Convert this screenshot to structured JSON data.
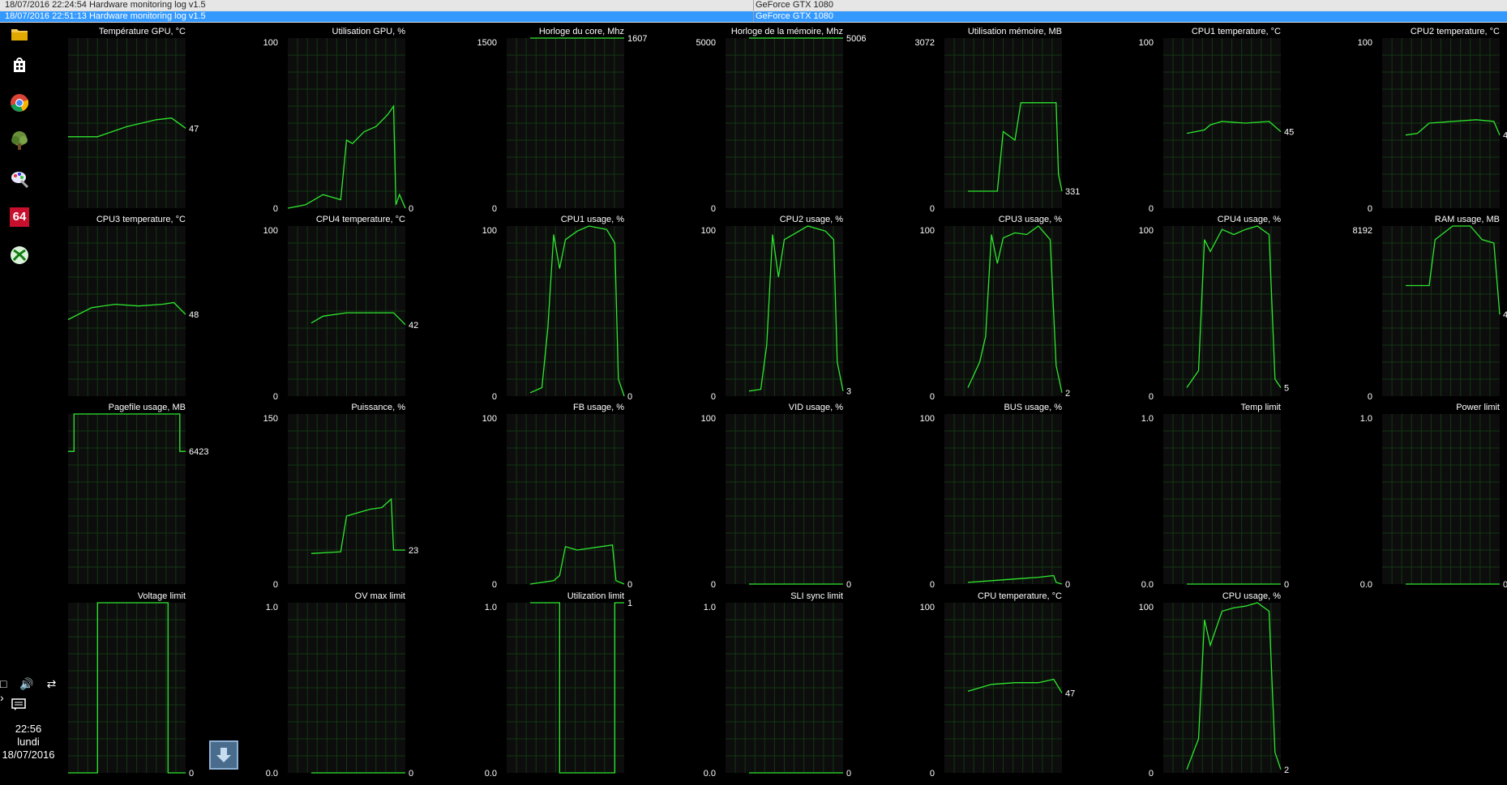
{
  "window": {
    "rows": [
      {
        "col1": "18/07/2016 22:24:54 Hardware monitoring log v1.5",
        "col2": "GeForce GTX 1080"
      },
      {
        "col1": "18/07/2016 22:51:13 Hardware monitoring log v1.5",
        "col2": "GeForce GTX 1080"
      }
    ]
  },
  "taskbar": {
    "icons": [
      "folder-icon",
      "store-icon",
      "chrome-icon",
      "tree-app-icon",
      "paint-icon",
      "aida64-icon",
      "xbox-icon"
    ],
    "aida_label": "64",
    "tray_icons": "□ 🔊 ⇄ ›",
    "time": "22:56",
    "day": "lundi",
    "date": "18/07/2016"
  },
  "colors": {
    "line": "#2ee82e",
    "grid": "#123812",
    "frame": "#0d0d0d"
  },
  "graphs": [
    {
      "title": "Température GPU, °C",
      "ymin": "",
      "ymax": "",
      "current": "47",
      "trace": [
        [
          0,
          42
        ],
        [
          0.25,
          42
        ],
        [
          0.5,
          48
        ],
        [
          0.75,
          52
        ],
        [
          0.88,
          53
        ],
        [
          1,
          47
        ]
      ]
    },
    {
      "title": "Utilisation GPU, %",
      "ymin": "0",
      "ymax": "100",
      "current": "0",
      "trace": [
        [
          0,
          0
        ],
        [
          0.15,
          2
        ],
        [
          0.3,
          8
        ],
        [
          0.45,
          5
        ],
        [
          0.5,
          40
        ],
        [
          0.55,
          38
        ],
        [
          0.65,
          45
        ],
        [
          0.75,
          48
        ],
        [
          0.85,
          55
        ],
        [
          0.9,
          60
        ],
        [
          0.92,
          2
        ],
        [
          0.95,
          8
        ],
        [
          1,
          0
        ]
      ]
    },
    {
      "title": "Horloge du core, Mhz",
      "ymin": "0",
      "ymax": "1500",
      "current": "1607",
      "trace": [
        [
          0.2,
          100
        ],
        [
          1,
          100
        ]
      ]
    },
    {
      "title": "Horloge de la mémoire, Mhz",
      "ymin": "0",
      "ymax": "5000",
      "current": "5006",
      "trace": [
        [
          0.2,
          100
        ],
        [
          1,
          100
        ]
      ]
    },
    {
      "title": "Utilisation mémoire, MB",
      "ymin": "0",
      "ymax": "3072",
      "current": "331",
      "trace": [
        [
          0.2,
          10
        ],
        [
          0.45,
          10
        ],
        [
          0.5,
          45
        ],
        [
          0.6,
          40
        ],
        [
          0.65,
          62
        ],
        [
          0.7,
          62
        ],
        [
          0.75,
          62
        ],
        [
          0.95,
          62
        ],
        [
          0.97,
          20
        ],
        [
          1,
          10
        ]
      ]
    },
    {
      "title": "CPU1 temperature, °C",
      "ymin": "0",
      "ymax": "100",
      "current": "45",
      "trace": [
        [
          0.2,
          44
        ],
        [
          0.35,
          46
        ],
        [
          0.4,
          49
        ],
        [
          0.5,
          51
        ],
        [
          0.7,
          50
        ],
        [
          0.9,
          51
        ],
        [
          1,
          45
        ]
      ]
    },
    {
      "title": "CPU2 temperature, °C",
      "ymin": "0",
      "ymax": "100",
      "current": "4",
      "trace": [
        [
          0.2,
          43
        ],
        [
          0.3,
          44
        ],
        [
          0.4,
          50
        ],
        [
          0.6,
          51
        ],
        [
          0.8,
          52
        ],
        [
          0.95,
          51
        ],
        [
          1,
          43
        ]
      ]
    },
    {
      "title": "CPU3 temperature, °C",
      "ymin": "",
      "ymax": "",
      "current": "48",
      "trace": [
        [
          0,
          45
        ],
        [
          0.2,
          52
        ],
        [
          0.4,
          54
        ],
        [
          0.6,
          53
        ],
        [
          0.8,
          54
        ],
        [
          0.9,
          55
        ],
        [
          1,
          48
        ]
      ]
    },
    {
      "title": "CPU4 temperature, °C",
      "ymin": "0",
      "ymax": "100",
      "current": "42",
      "trace": [
        [
          0.2,
          43
        ],
        [
          0.3,
          47
        ],
        [
          0.5,
          49
        ],
        [
          0.7,
          49
        ],
        [
          0.9,
          49
        ],
        [
          1,
          42
        ]
      ]
    },
    {
      "title": "CPU1 usage, %",
      "ymin": "0",
      "ymax": "100",
      "current": "0",
      "trace": [
        [
          0.2,
          2
        ],
        [
          0.3,
          5
        ],
        [
          0.35,
          40
        ],
        [
          0.4,
          95
        ],
        [
          0.45,
          75
        ],
        [
          0.5,
          92
        ],
        [
          0.6,
          97
        ],
        [
          0.7,
          100
        ],
        [
          0.85,
          98
        ],
        [
          0.92,
          90
        ],
        [
          0.95,
          10
        ],
        [
          1,
          0
        ]
      ]
    },
    {
      "title": "CPU2 usage, %",
      "ymin": "0",
      "ymax": "100",
      "current": "3",
      "trace": [
        [
          0.2,
          3
        ],
        [
          0.3,
          4
        ],
        [
          0.35,
          30
        ],
        [
          0.4,
          95
        ],
        [
          0.45,
          70
        ],
        [
          0.5,
          92
        ],
        [
          0.6,
          96
        ],
        [
          0.7,
          100
        ],
        [
          0.85,
          97
        ],
        [
          0.92,
          92
        ],
        [
          0.95,
          20
        ],
        [
          1,
          3
        ]
      ]
    },
    {
      "title": "CPU3 usage, %",
      "ymin": "0",
      "ymax": "100",
      "current": "2",
      "trace": [
        [
          0.2,
          5
        ],
        [
          0.3,
          20
        ],
        [
          0.35,
          35
        ],
        [
          0.4,
          95
        ],
        [
          0.45,
          78
        ],
        [
          0.5,
          93
        ],
        [
          0.6,
          96
        ],
        [
          0.7,
          95
        ],
        [
          0.8,
          100
        ],
        [
          0.9,
          92
        ],
        [
          0.95,
          18
        ],
        [
          1,
          2
        ]
      ]
    },
    {
      "title": "CPU4 usage, %",
      "ymin": "0",
      "ymax": "100",
      "current": "5",
      "trace": [
        [
          0.2,
          5
        ],
        [
          0.3,
          15
        ],
        [
          0.35,
          92
        ],
        [
          0.4,
          85
        ],
        [
          0.5,
          98
        ],
        [
          0.6,
          95
        ],
        [
          0.7,
          98
        ],
        [
          0.8,
          100
        ],
        [
          0.9,
          95
        ],
        [
          0.95,
          10
        ],
        [
          1,
          5
        ]
      ]
    },
    {
      "title": "RAM usage, MB",
      "ymin": "0",
      "ymax": "8192",
      "current": "4",
      "trace": [
        [
          0.2,
          65
        ],
        [
          0.4,
          65
        ],
        [
          0.45,
          92
        ],
        [
          0.6,
          100
        ],
        [
          0.75,
          100
        ],
        [
          0.85,
          92
        ],
        [
          0.95,
          90
        ],
        [
          1,
          48
        ]
      ]
    },
    {
      "title": "Pagefile usage, MB",
      "ymin": "",
      "ymax": "",
      "current": "6423",
      "trace": [
        [
          0,
          78
        ],
        [
          0.05,
          78
        ],
        [
          0.05,
          100
        ],
        [
          0.95,
          100
        ],
        [
          0.95,
          78
        ],
        [
          1,
          78
        ]
      ]
    },
    {
      "title": "Puissance, %",
      "ymin": "0",
      "ymax": "150",
      "current": "23",
      "trace": [
        [
          0.2,
          18
        ],
        [
          0.45,
          19
        ],
        [
          0.5,
          40
        ],
        [
          0.6,
          42
        ],
        [
          0.7,
          44
        ],
        [
          0.8,
          45
        ],
        [
          0.88,
          50
        ],
        [
          0.9,
          20
        ],
        [
          1,
          20
        ]
      ]
    },
    {
      "title": "FB usage, %",
      "ymin": "0",
      "ymax": "100",
      "current": "0",
      "trace": [
        [
          0.2,
          0
        ],
        [
          0.4,
          2
        ],
        [
          0.45,
          5
        ],
        [
          0.5,
          22
        ],
        [
          0.6,
          20
        ],
        [
          0.7,
          21
        ],
        [
          0.8,
          22
        ],
        [
          0.9,
          23
        ],
        [
          0.93,
          2
        ],
        [
          1,
          0
        ]
      ]
    },
    {
      "title": "VID usage, %",
      "ymin": "0",
      "ymax": "100",
      "current": "0",
      "trace": [
        [
          0.2,
          0
        ],
        [
          1,
          0
        ]
      ]
    },
    {
      "title": "BUS usage, %",
      "ymin": "0",
      "ymax": "100",
      "current": "0",
      "trace": [
        [
          0.2,
          1
        ],
        [
          0.4,
          2
        ],
        [
          0.6,
          3
        ],
        [
          0.8,
          4
        ],
        [
          0.93,
          5
        ],
        [
          0.95,
          1
        ],
        [
          1,
          0
        ]
      ]
    },
    {
      "title": "Temp limit",
      "ymin": "0.0",
      "ymax": "1.0",
      "current": "0",
      "trace": [
        [
          0.2,
          0
        ],
        [
          1,
          0
        ]
      ]
    },
    {
      "title": "Power limit",
      "ymin": "0.0",
      "ymax": "1.0",
      "current": "0",
      "trace": [
        [
          0.2,
          0
        ],
        [
          1,
          0
        ]
      ]
    },
    {
      "title": "Voltage limit",
      "ymin": "",
      "ymax": "",
      "current": "0",
      "trace": [
        [
          0,
          0
        ],
        [
          0.25,
          0
        ],
        [
          0.25,
          100
        ],
        [
          0.85,
          100
        ],
        [
          0.85,
          0
        ],
        [
          1,
          0
        ]
      ]
    },
    {
      "title": "OV max limit",
      "ymin": "0.0",
      "ymax": "1.0",
      "current": "0",
      "trace": [
        [
          0.2,
          0
        ],
        [
          1,
          0
        ]
      ]
    },
    {
      "title": "Utilization limit",
      "ymin": "0.0",
      "ymax": "1.0",
      "current": "1",
      "trace": [
        [
          0.2,
          100
        ],
        [
          0.45,
          100
        ],
        [
          0.45,
          0
        ],
        [
          0.92,
          0
        ],
        [
          0.92,
          100
        ],
        [
          1,
          100
        ]
      ]
    },
    {
      "title": "SLI sync limit",
      "ymin": "0.0",
      "ymax": "1.0",
      "current": "0",
      "trace": [
        [
          0.2,
          0
        ],
        [
          1,
          0
        ]
      ]
    },
    {
      "title": "CPU temperature, °C",
      "ymin": "0",
      "ymax": "100",
      "current": "47",
      "trace": [
        [
          0.2,
          48
        ],
        [
          0.3,
          50
        ],
        [
          0.4,
          52
        ],
        [
          0.6,
          53
        ],
        [
          0.8,
          53
        ],
        [
          0.93,
          55
        ],
        [
          1,
          47
        ]
      ]
    },
    {
      "title": "CPU usage, %",
      "ymin": "0",
      "ymax": "100",
      "current": "2",
      "trace": [
        [
          0.2,
          2
        ],
        [
          0.3,
          20
        ],
        [
          0.35,
          90
        ],
        [
          0.4,
          75
        ],
        [
          0.5,
          95
        ],
        [
          0.6,
          97
        ],
        [
          0.7,
          98
        ],
        [
          0.8,
          100
        ],
        [
          0.9,
          95
        ],
        [
          0.95,
          12
        ],
        [
          1,
          2
        ]
      ]
    }
  ]
}
